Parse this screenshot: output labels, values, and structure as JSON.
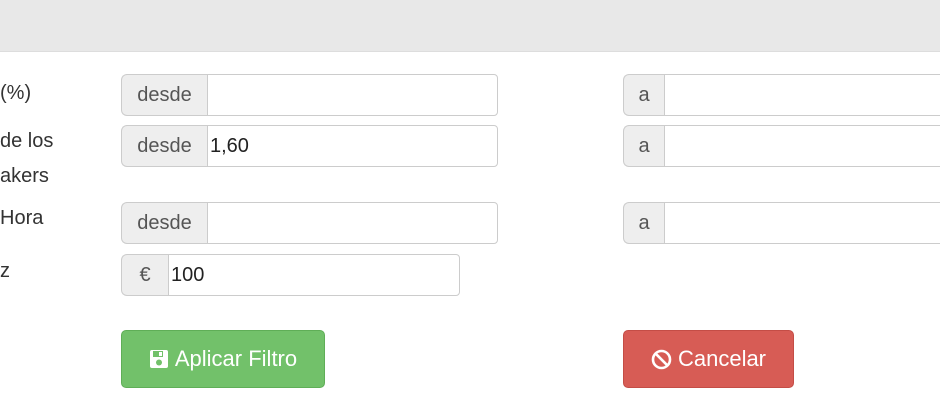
{
  "filters": {
    "row1": {
      "label": "(%)",
      "from_prefix": "desde",
      "from_value": "",
      "to_prefix": "a",
      "to_value": ""
    },
    "row2": {
      "label_line1": "de los",
      "label_line2": "akers",
      "from_prefix": "desde",
      "from_value": "1,60",
      "to_prefix": "a",
      "to_value": ""
    },
    "row3": {
      "label": "Hora",
      "from_prefix": "desde",
      "from_value": "",
      "to_prefix": "a",
      "to_value": ""
    },
    "row4": {
      "label": "z",
      "currency_symbol": "€",
      "value": "100"
    }
  },
  "buttons": {
    "apply_label": "Aplicar Filtro",
    "cancel_label": "Cancelar"
  },
  "icons": {
    "apply": "floppy-disk-icon",
    "cancel": "ban-icon"
  },
  "colors": {
    "apply": "#72c16a",
    "cancel": "#d75c55",
    "topbar": "#e8e8e8"
  }
}
